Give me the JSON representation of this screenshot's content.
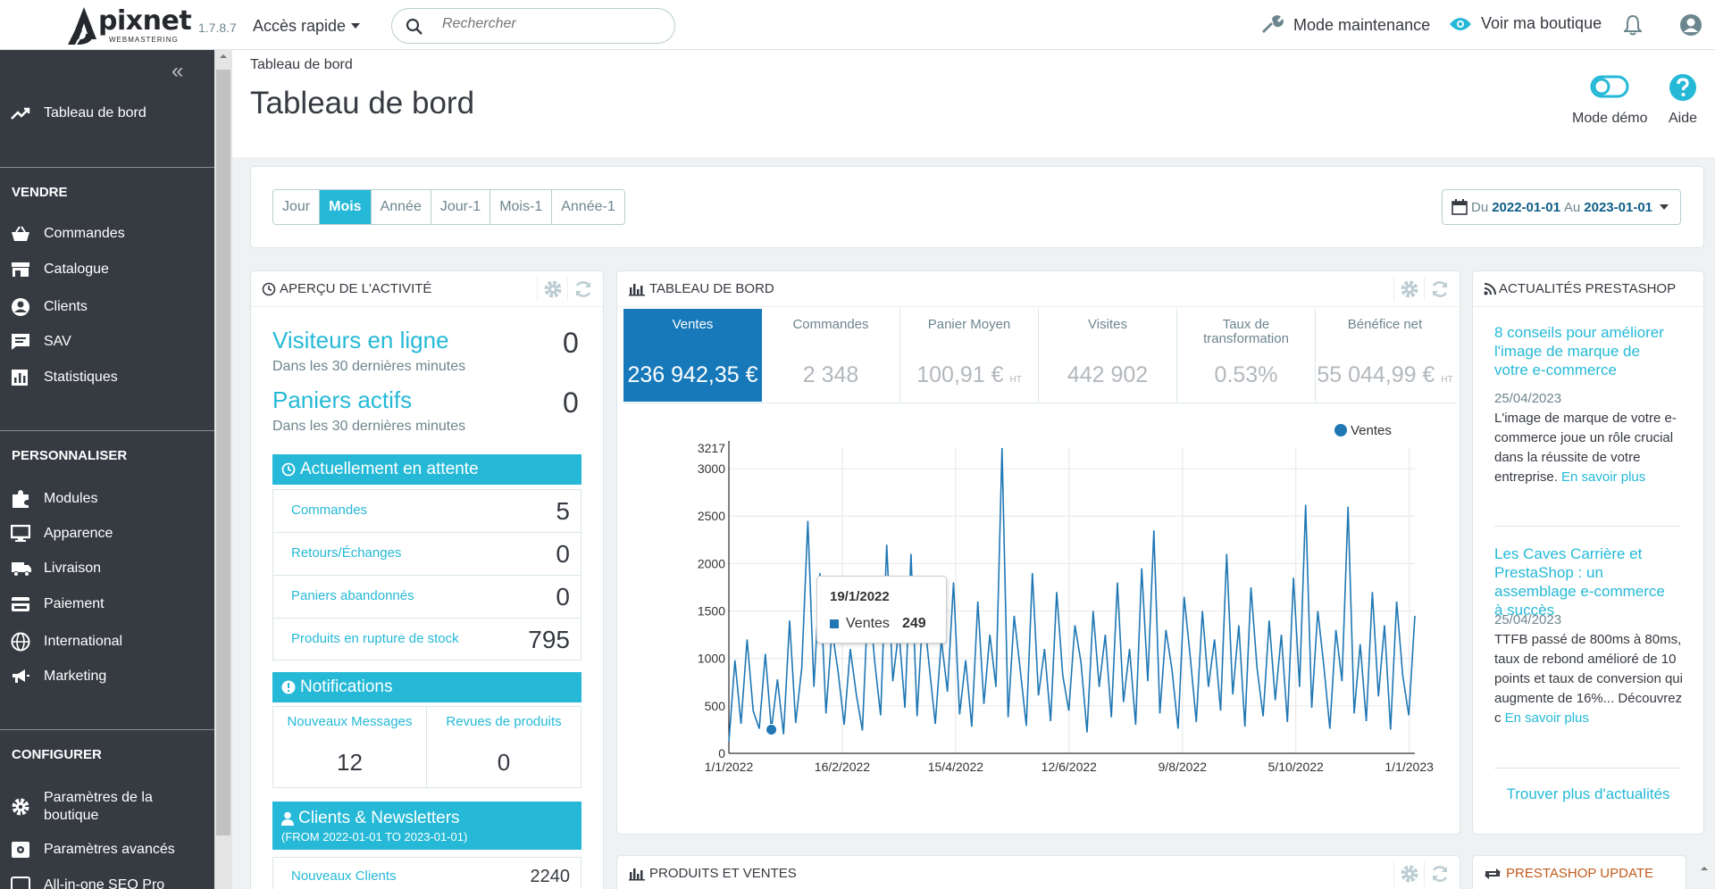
{
  "header": {
    "version": "1.7.8.7",
    "quick_access": "Accès rapide",
    "search_placeholder": "Rechercher",
    "maintenance": "Mode maintenance",
    "view_shop": "Voir ma boutique",
    "logo_text": "pixnet",
    "logo_sub": "WEBMASTERING"
  },
  "sidebar": {
    "dashboard": "Tableau de bord",
    "sections": [
      {
        "title": "VENDRE",
        "items": [
          "Commandes",
          "Catalogue",
          "Clients",
          "SAV",
          "Statistiques"
        ]
      },
      {
        "title": "PERSONNALISER",
        "items": [
          "Modules",
          "Apparence",
          "Livraison",
          "Paiement",
          "International",
          "Marketing"
        ]
      },
      {
        "title": "CONFIGURER",
        "items": [
          "Paramètres de la boutique",
          "Paramètres avancés",
          "All-in-one SEO Pro"
        ]
      }
    ]
  },
  "page": {
    "breadcrumb": "Tableau de bord",
    "title": "Tableau de bord",
    "demo_mode": "Mode démo",
    "help": "Aide"
  },
  "filters": {
    "periods": [
      "Jour",
      "Mois",
      "Année",
      "Jour-1",
      "Mois-1",
      "Année-1"
    ],
    "active": "Mois",
    "date_prefix": "Du",
    "date_from": "2022-01-01",
    "date_mid": "Au",
    "date_to": "2023-01-01"
  },
  "activity": {
    "title": "APERÇU DE L'ACTIVITÉ",
    "visitors_label": "Visiteurs en ligne",
    "visitors_value": "0",
    "visitors_sub": "Dans les 30 dernières minutes",
    "carts_label": "Paniers actifs",
    "carts_value": "0",
    "carts_sub": "Dans les 30 dernières minutes",
    "pending_title": "Actuellement en attente",
    "pending": [
      {
        "label": "Commandes",
        "value": "5"
      },
      {
        "label": "Retours/Échanges",
        "value": "0"
      },
      {
        "label": "Paniers abandonnés",
        "value": "0"
      },
      {
        "label": "Produits en rupture de stock",
        "value": "795"
      }
    ],
    "notif_title": "Notifications",
    "notif_messages_label": "Nouveaux Messages",
    "notif_messages_value": "12",
    "notif_reviews_label": "Revues de produits",
    "notif_reviews_value": "0",
    "clients_title": "Clients & Newsletters",
    "clients_sub": "(FROM 2022-01-01 TO 2023-01-01)",
    "new_clients_label": "Nouveaux Clients",
    "new_clients_value": "2240"
  },
  "dashboard": {
    "title": "TABLEAU DE BORD",
    "kpis": [
      {
        "label": "Ventes",
        "value": "236 942,35 €",
        "ht": ""
      },
      {
        "label": "Commandes",
        "value": "2 348",
        "ht": ""
      },
      {
        "label": "Panier Moyen",
        "value": "100,91 €",
        "ht": "HT"
      },
      {
        "label": "Visites",
        "value": "442 902",
        "ht": ""
      },
      {
        "label": "Taux de transformation",
        "value": "0.53%",
        "ht": ""
      },
      {
        "label": "Bénéfice net",
        "value": "55 044,99 €",
        "ht": "HT"
      }
    ],
    "tooltip_date": "19/1/2022",
    "tooltip_series": "Ventes",
    "tooltip_value": "249"
  },
  "chart_data": {
    "type": "line",
    "title": "",
    "xlabel": "",
    "ylabel": "",
    "ylim": [
      0,
      3217
    ],
    "y_ticks": [
      "0",
      "500",
      "1000",
      "1500",
      "2000",
      "2500",
      "3000",
      "3217"
    ],
    "x_ticks": [
      "1/1/2022",
      "16/2/2022",
      "15/4/2022",
      "12/6/2022",
      "9/8/2022",
      "5/10/2022",
      "1/1/2023"
    ],
    "legend": "top-right",
    "grid": true,
    "color": "#1f77b4",
    "series": [
      {
        "name": "Ventes",
        "values": [
          120,
          980,
          310,
          1200,
          450,
          260,
          1050,
          249,
          780,
          200,
          1400,
          320,
          900,
          2450,
          700,
          1900,
          420,
          1300,
          860,
          300,
          1100,
          620,
          240,
          1750,
          980,
          400,
          2200,
          760,
          1300,
          480,
          2100,
          390,
          1550,
          920,
          310,
          1200,
          650,
          1800,
          410,
          980,
          280,
          1600,
          520,
          1250,
          700,
          3217,
          380,
          1450,
          880,
          290,
          1900,
          610,
          1100,
          340,
          1700,
          820,
          450,
          1350,
          960,
          220,
          1500,
          700,
          1250,
          380,
          1800,
          540,
          1100,
          300,
          1950,
          760,
          2350,
          420,
          1300,
          880,
          260,
          1650,
          1020,
          330,
          1500,
          700,
          1200,
          450,
          2100,
          620,
          1350,
          280,
          1750,
          900,
          390,
          1400,
          560,
          1250,
          330,
          1850,
          700,
          2620,
          480,
          1500,
          920,
          260,
          1300,
          760,
          2600,
          420,
          1150,
          340,
          1700,
          600,
          1350,
          250,
          1600,
          820,
          400,
          1450
        ]
      }
    ]
  },
  "news": {
    "title": "ACTUALITÉS PRESTASHOP",
    "items": [
      {
        "title": "8 conseils pour améliorer l'image de marque de votre e-commerce",
        "date": "25/04/2023",
        "body": "L'image de marque de votre e-commerce joue un rôle crucial dans la réussite de votre entreprise.",
        "more": "En savoir plus"
      },
      {
        "title": "Les Caves Carrière et PrestaShop : un assemblage e-commerce à succès",
        "date": "25/04/2023",
        "body": "TTFB  passé de 800ms à 80ms, taux de rebond amélioré de 10 points et taux de conversion qui augmente de 16%... Découvrez c",
        "more": "En savoir plus"
      }
    ],
    "more_news": "Trouver plus d'actualités"
  },
  "products_panel_title": "PRODUITS ET VENTES",
  "update_panel_title": "PRESTASHOP UPDATE"
}
